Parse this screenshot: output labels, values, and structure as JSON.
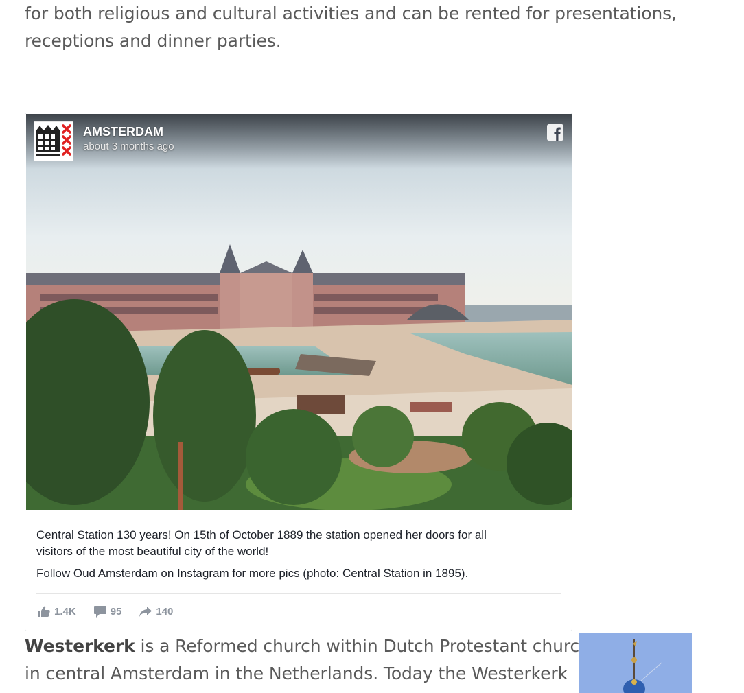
{
  "intro": {
    "line1": "for both religious and cultural activities and can be rented for presentations,",
    "line2": "receptions and dinner parties."
  },
  "fb_post": {
    "page_name": "AMSTERDAM",
    "time_ago": "about 3 months ago",
    "caption_p1_line1": "Central Station 130 years! On 15th of October 1889 the station opened her doors for all",
    "caption_p1_line2": "visitors of the most beautiful city of the world!",
    "caption_p2": "Follow Oud Amsterdam on Instagram for more pics (photo: Central Station in 1895).",
    "likes": "1.4K",
    "comments": "95",
    "shares": "140",
    "icons": {
      "logo": "facebook-icon",
      "avatar": "amsterdam-crest-avatar",
      "like": "thumbs-up-icon",
      "comment": "comment-bubble-icon",
      "share": "share-arrow-icon"
    },
    "stat_color": "#8d949e"
  },
  "westerkerk": {
    "term": "Westerkerk",
    "line1_rest": " is a Reformed church within Dutch Protestant church",
    "line2": "in central Amsterdam in the Netherlands. Today the Westerkerk"
  },
  "colors": {
    "body_text": "#5a5a5a",
    "card_border": "#dddfe2",
    "side_image_sky": "#8faee6"
  }
}
